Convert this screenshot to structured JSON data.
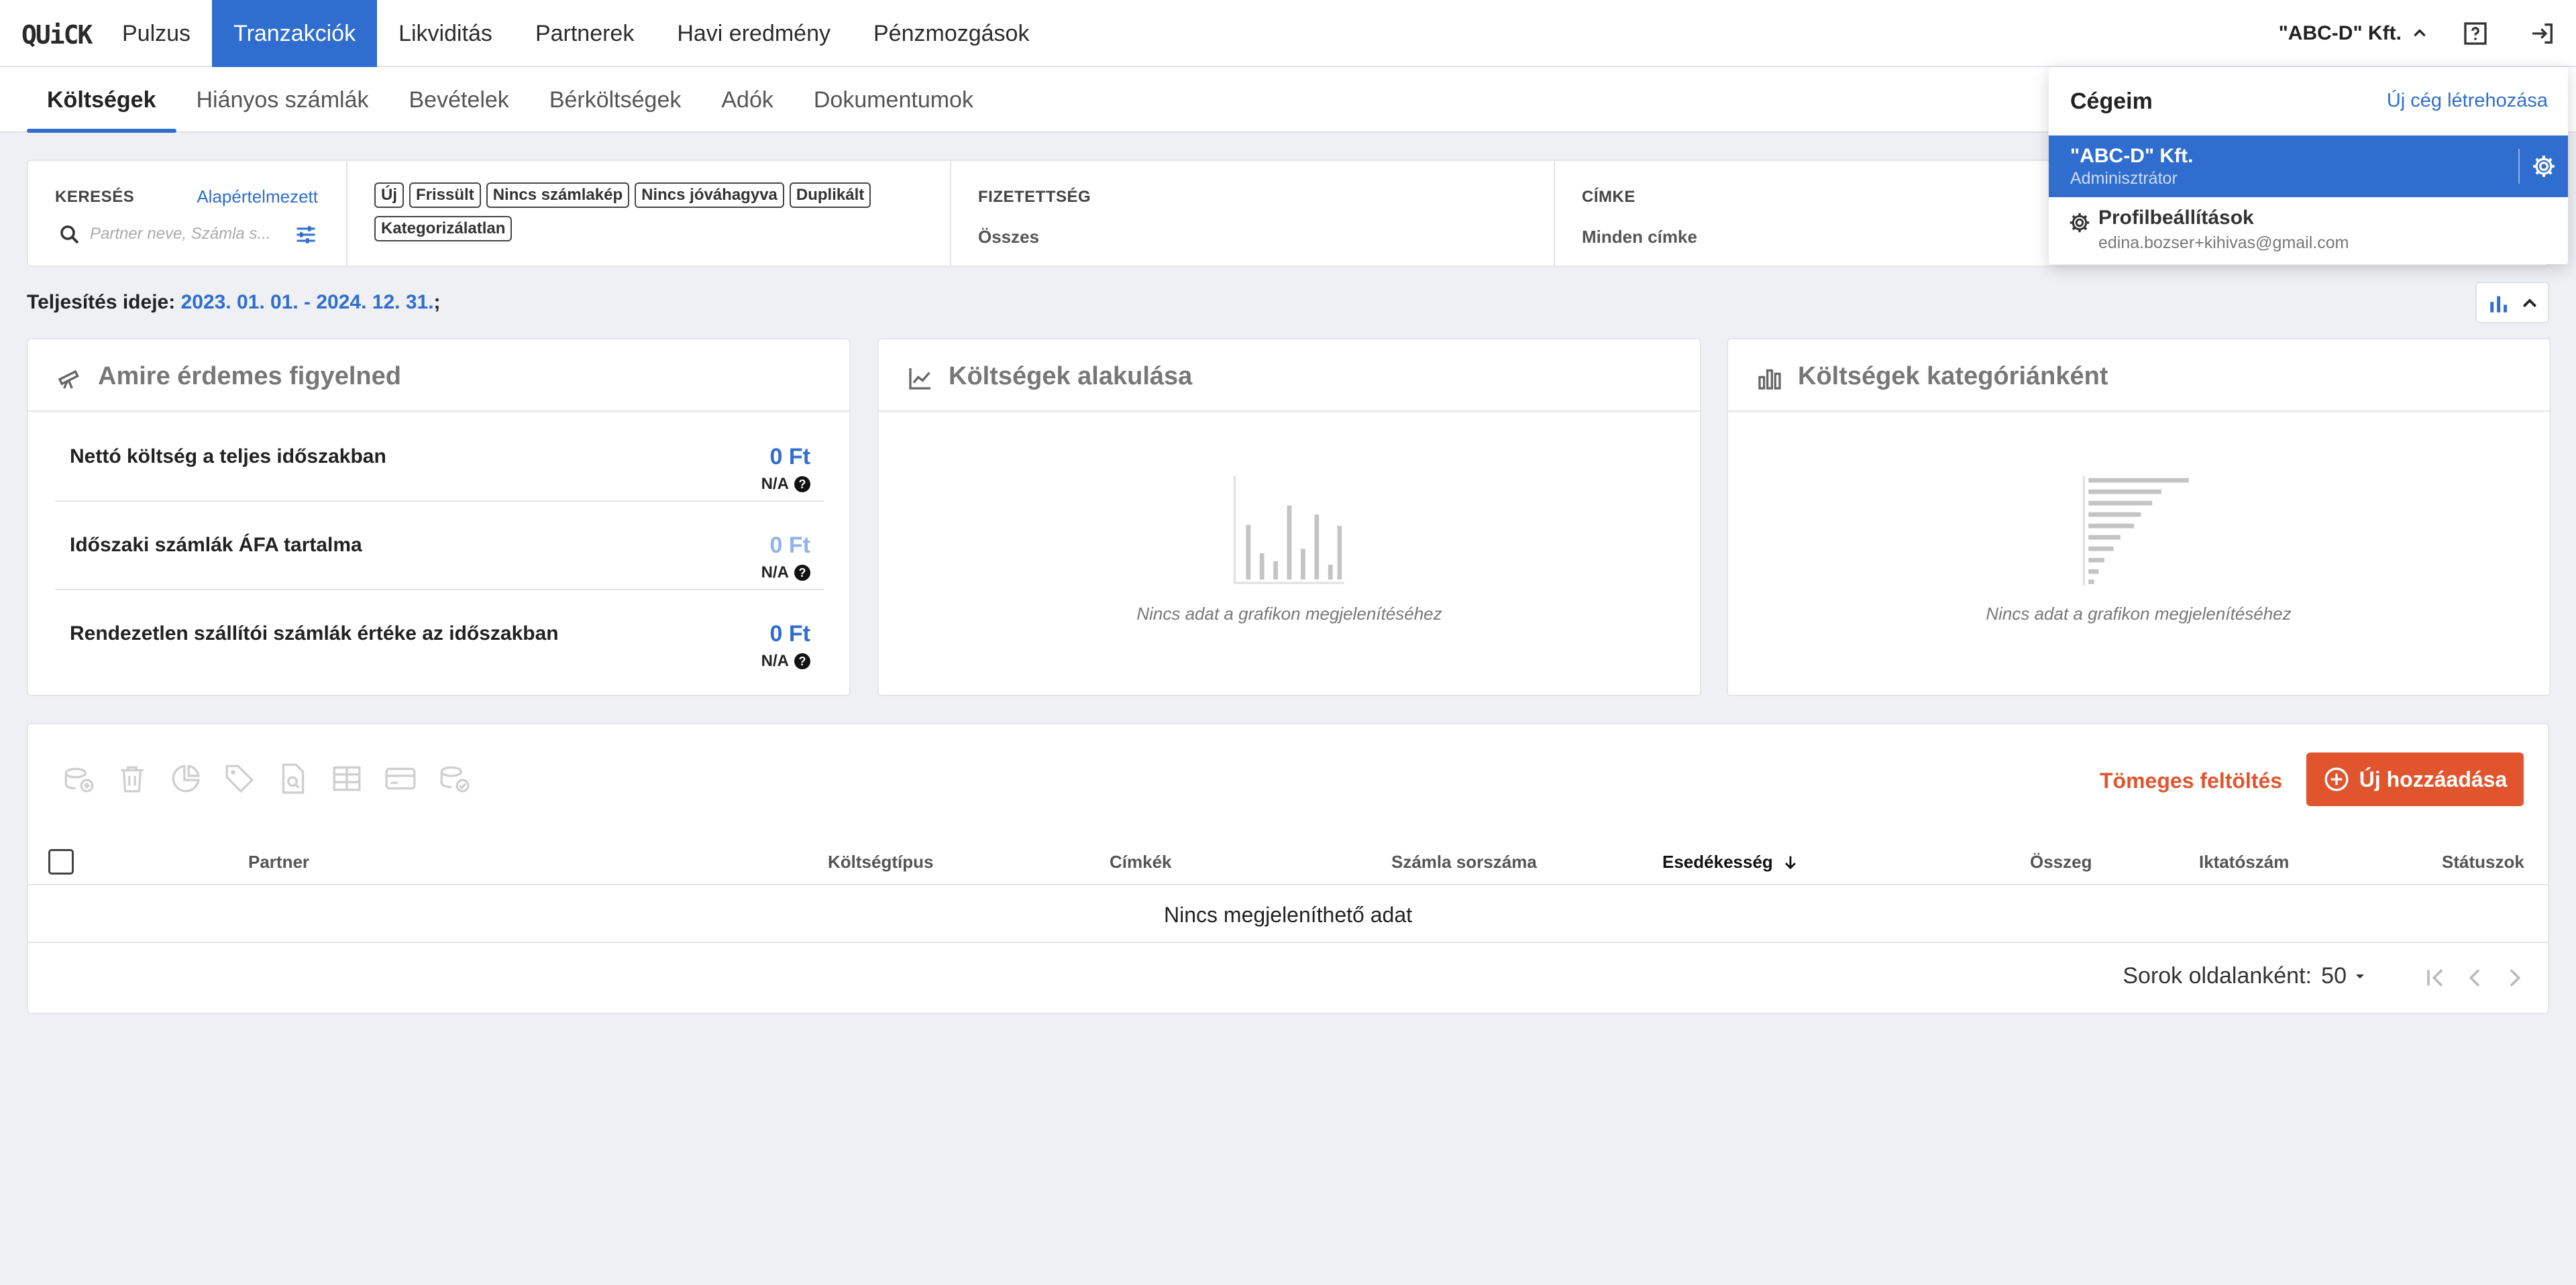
{
  "app": {
    "logo": "QUiCK",
    "nav": [
      "Pulzus",
      "Tranzakciók",
      "Likviditás",
      "Partnerek",
      "Havi eredmény",
      "Pénzmozgások"
    ],
    "active_nav": "Tranzakciók",
    "company": "\"ABC-D\" Kft."
  },
  "subnav": {
    "items": [
      "Költségek",
      "Hiányos számlák",
      "Bevételek",
      "Bérköltségek",
      "Adók",
      "Dokumentumok"
    ],
    "active": "Költségek"
  },
  "filters": {
    "search": {
      "title": "KERESÉS",
      "reset": "Alapértelmezett",
      "placeholder": "Partner neve, Számla s..."
    },
    "chips": [
      "Új",
      "Frissült",
      "Nincs számlakép",
      "Nincs jóváhagyva",
      "Duplikált",
      "Kategorizálatlan"
    ],
    "payment": {
      "title": "FIZETETTSÉG",
      "value": "Összes"
    },
    "tag": {
      "title": "CÍMKE",
      "value": "Minden címke"
    }
  },
  "dropdown": {
    "title": "Cégeim",
    "new_company": "Új cég létrehozása",
    "company_name": "\"ABC-D\" Kft.",
    "company_role": "Adminisztrátor",
    "profile": "Profilbeállítások",
    "email": "edina.bozser+kihivas@gmail.com"
  },
  "period": {
    "label": "Teljesítés ideje:",
    "range": "2023. 01. 01. - 2024. 12. 31.",
    "suffix": ";"
  },
  "cards": {
    "watch": {
      "title": "Amire érdemes figyelned",
      "metrics": [
        {
          "label": "Nettó költség a teljes időszakban",
          "value": "0 Ft",
          "sub": "N/A"
        },
        {
          "label": "Időszaki számlák ÁFA tartalma",
          "value": "0 Ft",
          "sub": "N/A"
        },
        {
          "label": "Rendezetlen szállítói számlák értéke az időszakban",
          "value": "0 Ft",
          "sub": "N/A"
        }
      ]
    },
    "trend": {
      "title": "Költségek alakulása",
      "empty": "Nincs adat a grafikon megjelenítéséhez"
    },
    "category": {
      "title": "Költségek kategóriánként",
      "empty": "Nincs adat a grafikon megjelenítéséhez"
    }
  },
  "table": {
    "bulk_upload": "Tömeges feltöltés",
    "add_new": "Új hozzáadása",
    "columns": [
      "Partner",
      "Költségtípus",
      "Címkék",
      "Számla sorszáma",
      "Esedékesség",
      "Összeg",
      "Iktatószám",
      "Státuszok"
    ],
    "empty": "Nincs megjeleníthető adat",
    "rows_per_page_label": "Sorok oldalanként:",
    "rows_per_page": "50"
  },
  "colors": {
    "primary": "#2f6ecf",
    "accent": "#e0552e"
  }
}
